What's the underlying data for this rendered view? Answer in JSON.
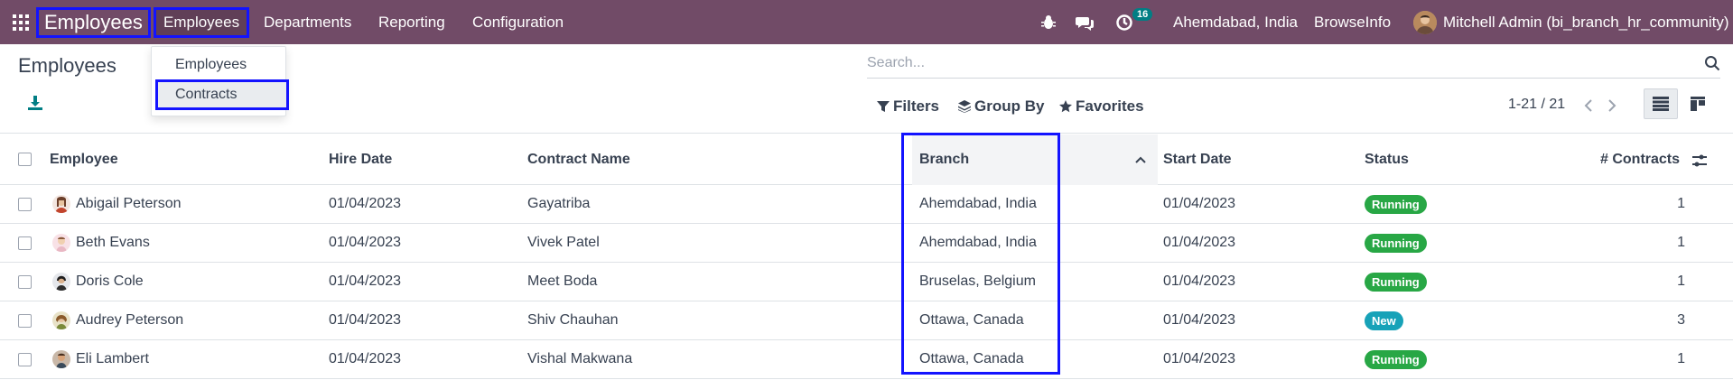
{
  "navbar": {
    "app_name": "Employees",
    "menus": [
      "Employees",
      "Departments",
      "Reporting",
      "Configuration"
    ],
    "activity_count": "16",
    "company": "Ahemdabad, India",
    "branch_company": "BrowseInfo",
    "user": "Mitchell Admin (bi_branch_hr_community)"
  },
  "dropdown": {
    "items": [
      "Employees",
      "Contracts"
    ]
  },
  "control_panel": {
    "title": "Employees",
    "search_placeholder": "Search...",
    "filters": "Filters",
    "group_by": "Group By",
    "favorites": "Favorites",
    "pager": "1-21 / 21"
  },
  "table": {
    "headers": [
      "Employee",
      "Hire Date",
      "Contract Name",
      "Branch",
      "Start Date",
      "Status",
      "# Contracts"
    ],
    "rows": [
      {
        "employee": "Abigail Peterson",
        "hire_date": "01/04/2023",
        "contract": "Gayatriba",
        "branch": "Ahemdabad, India",
        "start_date": "01/04/2023",
        "status": "Running",
        "contracts": "1"
      },
      {
        "employee": "Beth Evans",
        "hire_date": "01/04/2023",
        "contract": "Vivek Patel",
        "branch": "Ahemdabad, India",
        "start_date": "01/04/2023",
        "status": "Running",
        "contracts": "1"
      },
      {
        "employee": "Doris Cole",
        "hire_date": "01/04/2023",
        "contract": "Meet Boda",
        "branch": "Bruselas, Belgium",
        "start_date": "01/04/2023",
        "status": "Running",
        "contracts": "1"
      },
      {
        "employee": "Audrey Peterson",
        "hire_date": "01/04/2023",
        "contract": "Shiv Chauhan",
        "branch": "Ottawa, Canada",
        "start_date": "01/04/2023",
        "status": "New",
        "contracts": "3"
      },
      {
        "employee": "Eli Lambert",
        "hire_date": "01/04/2023",
        "contract": "Vishal Makwana",
        "branch": "Ottawa, Canada",
        "start_date": "01/04/2023",
        "status": "Running",
        "contracts": "1"
      }
    ]
  },
  "colors": {
    "navbar": "#714B67",
    "highlight_box": "#1313ff",
    "status_running": "#28a745",
    "status_new": "#17a2b8",
    "badge": "#017e84"
  }
}
